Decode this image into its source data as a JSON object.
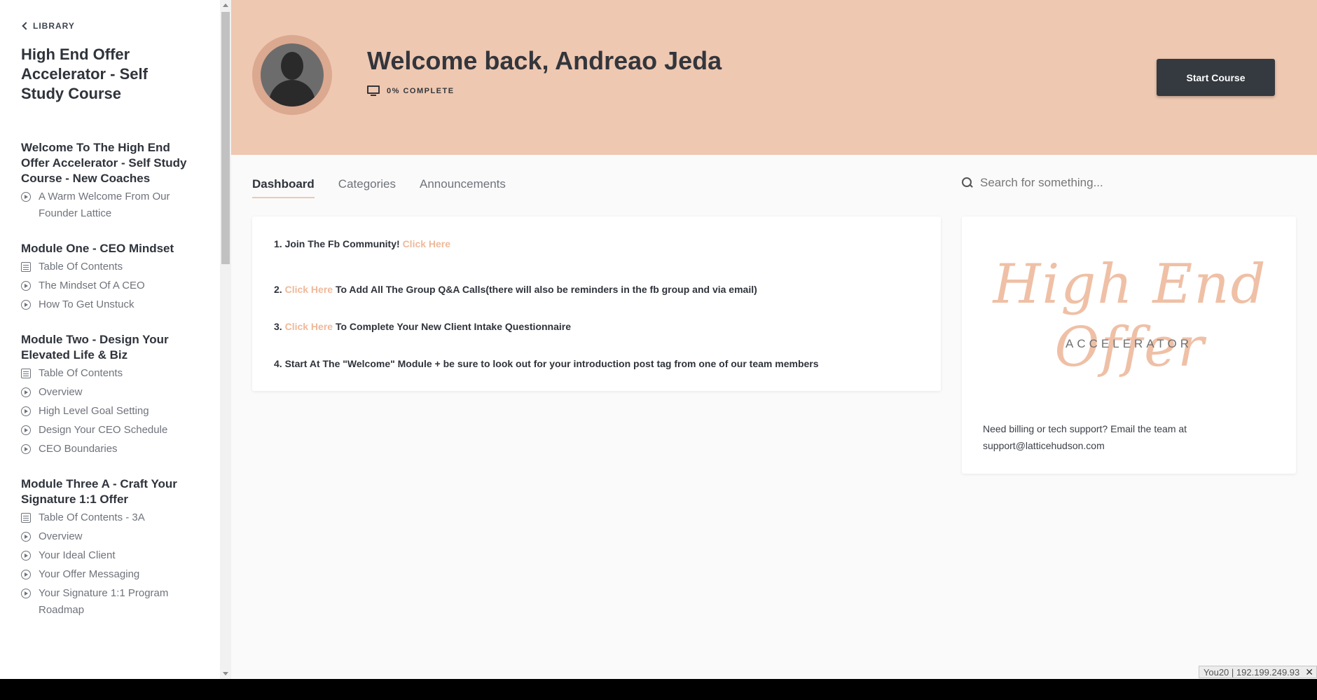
{
  "sidebar": {
    "back_label": "LIBRARY",
    "course_title": "High End Offer Accelerator - Self Study Course",
    "modules": [
      {
        "title": "Welcome To The High End Offer Accelerator - Self Study Course - New Coaches",
        "lessons": [
          {
            "icon": "play-circle-icon",
            "label": "A Warm Welcome From Our Founder Lattice"
          }
        ]
      },
      {
        "title": "Module One - CEO Mindset",
        "lessons": [
          {
            "icon": "document-icon",
            "label": "Table Of Contents"
          },
          {
            "icon": "play-circle-icon",
            "label": "The Mindset Of A CEO"
          },
          {
            "icon": "play-circle-icon",
            "label": "How To Get Unstuck"
          }
        ]
      },
      {
        "title": "Module Two - Design Your Elevated Life & Biz",
        "lessons": [
          {
            "icon": "document-icon",
            "label": "Table Of Contents"
          },
          {
            "icon": "play-circle-icon",
            "label": "Overview"
          },
          {
            "icon": "play-circle-icon",
            "label": "High Level Goal Setting"
          },
          {
            "icon": "play-circle-icon",
            "label": "Design Your CEO Schedule"
          },
          {
            "icon": "play-circle-icon",
            "label": "CEO Boundaries"
          }
        ]
      },
      {
        "title": "Module Three A - Craft Your Signature 1:1 Offer",
        "lessons": [
          {
            "icon": "document-icon",
            "label": "Table Of Contents - 3A"
          },
          {
            "icon": "play-circle-icon",
            "label": "Overview"
          },
          {
            "icon": "play-circle-icon",
            "label": "Your Ideal Client"
          },
          {
            "icon": "play-circle-icon",
            "label": "Your Offer Messaging"
          },
          {
            "icon": "play-circle-icon",
            "label": "Your Signature 1:1 Program Roadmap"
          }
        ]
      }
    ]
  },
  "header": {
    "welcome": "Welcome back, Andreao Jeda",
    "progress_label": "0% COMPLETE",
    "progress_percent": 0,
    "start_button": "Start Course",
    "banner_color": "#efc8b1"
  },
  "tabs": [
    {
      "label": "Dashboard",
      "active": true
    },
    {
      "label": "Categories",
      "active": false
    },
    {
      "label": "Announcements",
      "active": false
    }
  ],
  "search": {
    "placeholder": "Search for something..."
  },
  "announcements": {
    "link_text": "Click Here",
    "link_color": "#efb99a",
    "line1_prefix": "1. Join The Fb Community! ",
    "line2_prefix": "2. ",
    "line2_suffix": " To Add All The Group Q&A Calls(there will also be reminders in the fb group and via email)",
    "line3_prefix": "3. ",
    "line3_suffix": " To Complete Your New Client Intake Questionnaire",
    "line4": "4. Start At The \"Welcome\" Module + be sure to look out for your introduction post tag from one of our team members"
  },
  "promo": {
    "logo_script": "High End Offer",
    "logo_sub": "ACCELERATOR",
    "support_text": "Need billing or tech support? Email the team at support@latticehudson.com"
  },
  "status_bar": {
    "text": "You20 | 192.199.249.93",
    "close": "✕"
  }
}
